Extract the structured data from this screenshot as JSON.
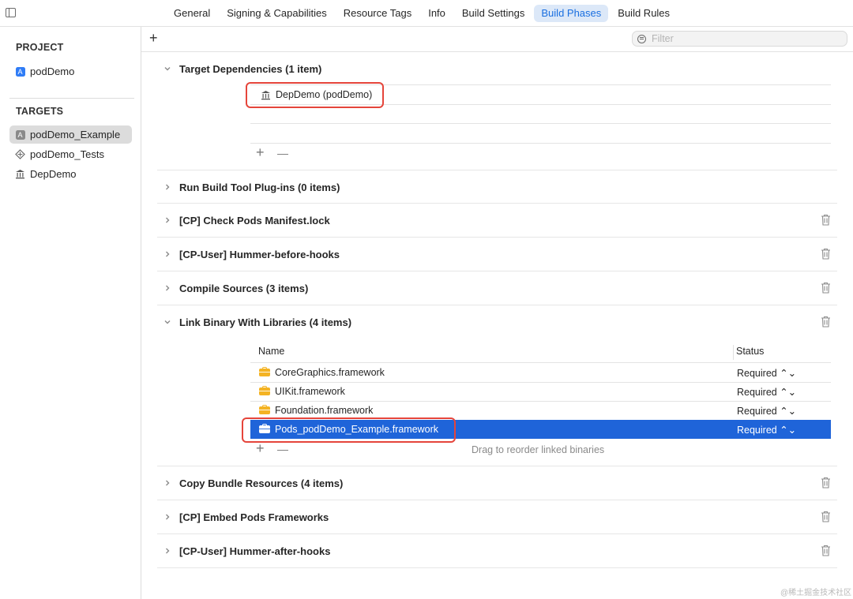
{
  "tabs": [
    {
      "label": "General"
    },
    {
      "label": "Signing & Capabilities"
    },
    {
      "label": "Resource Tags"
    },
    {
      "label": "Info"
    },
    {
      "label": "Build Settings"
    },
    {
      "label": "Build Phases",
      "active": true
    },
    {
      "label": "Build Rules"
    }
  ],
  "sidebar": {
    "project_header": "PROJECT",
    "project_item": "podDemo",
    "targets_header": "TARGETS",
    "targets": [
      {
        "label": "podDemo_Example",
        "icon": "app-icon",
        "selected": true
      },
      {
        "label": "podDemo_Tests",
        "icon": "test-bundle-icon"
      },
      {
        "label": "DepDemo",
        "icon": "framework-building-icon"
      }
    ]
  },
  "toolbar": {
    "add_symbol": "+",
    "filter_placeholder": "Filter"
  },
  "phases": {
    "target_dependencies": {
      "title": "Target Dependencies (1 item)",
      "expanded": true,
      "items": [
        "DepDemo (podDemo)"
      ]
    },
    "run_build_tool": {
      "title": "Run Build Tool Plug-ins (0 items)"
    },
    "check_pods": {
      "title": "[CP] Check Pods Manifest.lock"
    },
    "hummer_before": {
      "title": "[CP-User] Hummer-before-hooks"
    },
    "compile_sources": {
      "title": "Compile Sources (3 items)"
    },
    "link_binary": {
      "title": "Link Binary With Libraries (4 items)",
      "expanded": true,
      "columns": {
        "name": "Name",
        "status": "Status"
      },
      "rows": [
        {
          "name": "CoreGraphics.framework",
          "status": "Required ⌃⌄"
        },
        {
          "name": "UIKit.framework",
          "status": "Required ⌃⌄"
        },
        {
          "name": "Foundation.framework",
          "status": "Required ⌃⌄"
        },
        {
          "name": "Pods_podDemo_Example.framework",
          "status": "Required ⌃⌄",
          "selected": true
        }
      ],
      "hint": "Drag to reorder linked binaries"
    },
    "copy_bundle": {
      "title": "Copy Bundle Resources (4 items)"
    },
    "embed_pods": {
      "title": "[CP] Embed Pods Frameworks"
    },
    "hummer_after": {
      "title": "[CP-User] Hummer-after-hooks"
    }
  },
  "controls": {
    "plus": "+",
    "minus": "—"
  },
  "watermark": "@稀土掘金技术社区",
  "colors": {
    "accent": "#1a6fe0",
    "selection": "#1f64d9",
    "highlight_box": "#e5453b",
    "framework_icon": "#f4b323"
  }
}
